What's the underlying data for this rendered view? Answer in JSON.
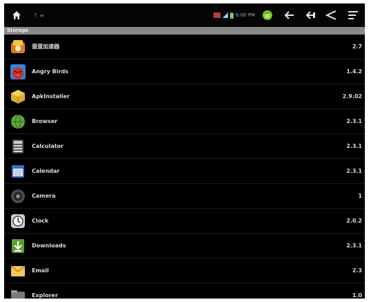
{
  "header": {
    "section_label": "Storage"
  },
  "statusbar": {
    "notification_text": "↑ ≡",
    "time": "6:00 PM"
  },
  "apps": [
    {
      "name": "蛋蛋加速器",
      "version": "2.7",
      "icon": "app-icon-orange"
    },
    {
      "name": "Angry Birds",
      "version": "1.4.2",
      "icon": "angry-birds-icon"
    },
    {
      "name": "ApkInstaller",
      "version": "2.9.02",
      "icon": "apk-installer-icon"
    },
    {
      "name": "Browser",
      "version": "2.3.1",
      "icon": "browser-globe-icon"
    },
    {
      "name": "Calculator",
      "version": "2.3.1",
      "icon": "calculator-icon"
    },
    {
      "name": "Calendar",
      "version": "2.3.1",
      "icon": "calendar-icon"
    },
    {
      "name": "Camera",
      "version": "1",
      "icon": "camera-icon"
    },
    {
      "name": "Clock",
      "version": "2.0.2",
      "icon": "clock-icon"
    },
    {
      "name": "Downloads",
      "version": "2.3.1",
      "icon": "download-arrow-icon"
    },
    {
      "name": "Email",
      "version": "2.3",
      "icon": "email-envelope-icon"
    },
    {
      "name": "Explorer",
      "version": "1.0",
      "icon": "explorer-icon"
    }
  ]
}
